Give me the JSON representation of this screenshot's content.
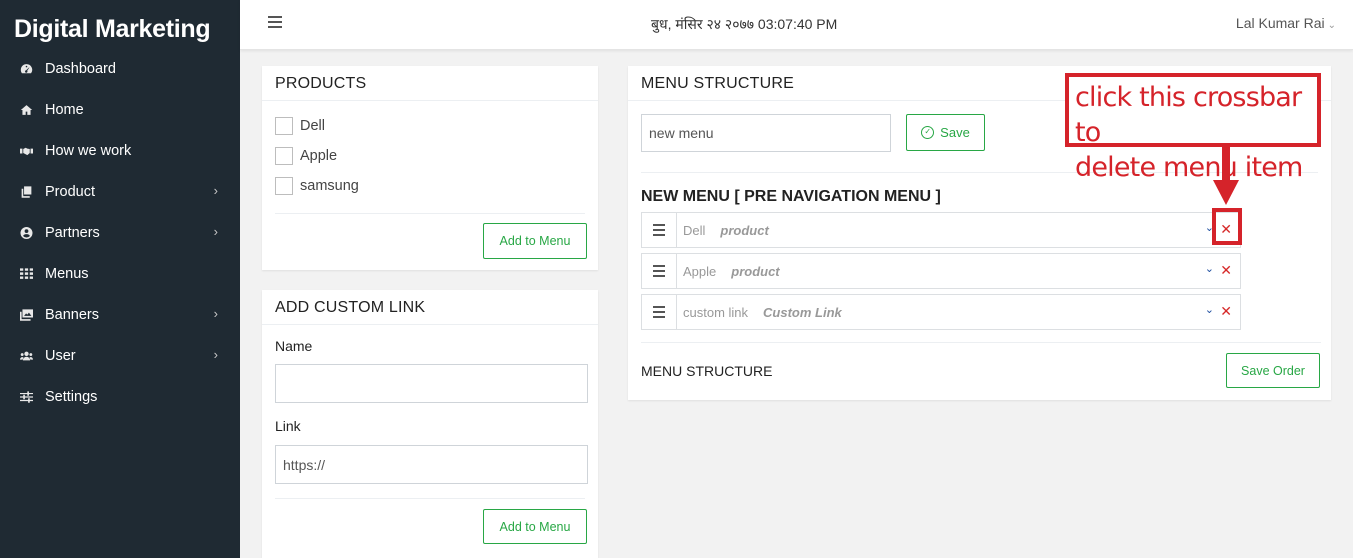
{
  "app": {
    "brand": "Digital Marketing"
  },
  "sidebar": {
    "items": [
      {
        "label": "Dashboard",
        "icon": "dashboard-icon",
        "has_submenu": false
      },
      {
        "label": "Home",
        "icon": "home-icon",
        "has_submenu": false
      },
      {
        "label": "How we work",
        "icon": "handshake-icon",
        "has_submenu": false
      },
      {
        "label": "Product",
        "icon": "copy-icon",
        "has_submenu": true
      },
      {
        "label": "Partners",
        "icon": "user-circle-icon",
        "has_submenu": true
      },
      {
        "label": "Menus",
        "icon": "grid-icon",
        "has_submenu": false
      },
      {
        "label": "Banners",
        "icon": "images-icon",
        "has_submenu": true
      },
      {
        "label": "User",
        "icon": "users-icon",
        "has_submenu": true
      },
      {
        "label": "Settings",
        "icon": "sliders-icon",
        "has_submenu": false
      }
    ]
  },
  "topbar": {
    "datetime": "बुध, मंसिर २४ २०७७ 03:07:40 PM",
    "user_name": "Lal Kumar Rai",
    "user_caret": "⌄"
  },
  "products": {
    "title": "PRODUCTS",
    "items": [
      "Dell",
      "Apple",
      "samsung"
    ],
    "add_button": "Add to Menu"
  },
  "custom_link": {
    "title": "ADD CUSTOM LINK",
    "name_label": "Name",
    "name_value": "",
    "link_label": "Link",
    "link_value": "https://",
    "add_button": "Add to Menu"
  },
  "menu_structure": {
    "title": "MENU STRUCTURE",
    "menu_name_value": "new menu",
    "save_label": "Save",
    "heading": "NEW MENU [ PRE NAVIGATION MENU ]",
    "items": [
      {
        "name": "Dell",
        "type": "product"
      },
      {
        "name": "Apple",
        "type": "product"
      },
      {
        "name": "custom link",
        "type": "Custom Link"
      }
    ],
    "footer_label": "MENU STRUCTURE",
    "save_order_label": "Save Order"
  },
  "annotation": {
    "text_line1": "click this crossbar to",
    "text_line2": "delete menu item"
  },
  "colors": {
    "sidebar_bg": "#1f2a33",
    "accent_green": "#28a745",
    "delete_red": "#d62828",
    "annotation_red": "#d5232a"
  }
}
